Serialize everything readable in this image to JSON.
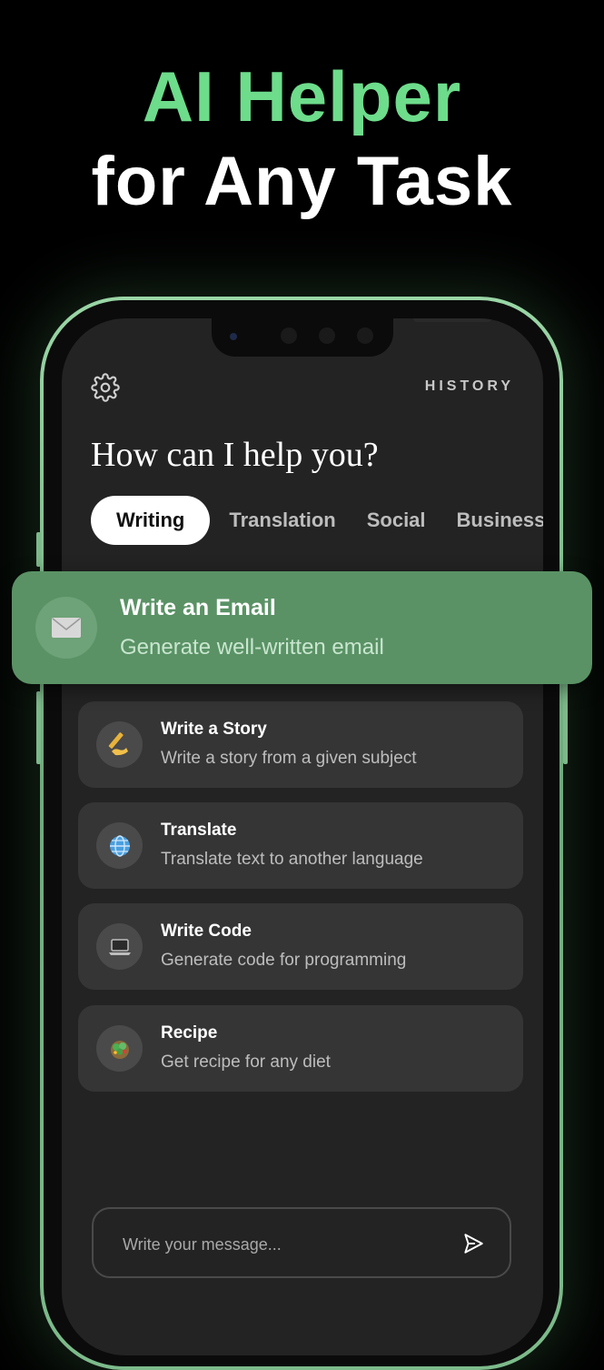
{
  "hero": {
    "line1": "AI Helper",
    "line2": "for Any Task"
  },
  "app": {
    "history_label": "HISTORY",
    "heading": "How can I help you?",
    "tabs": [
      {
        "label": "Writing",
        "active": true
      },
      {
        "label": "Translation",
        "active": false
      },
      {
        "label": "Social",
        "active": false
      },
      {
        "label": "Business",
        "active": false
      }
    ],
    "featured": {
      "title": "Write an Email",
      "subtitle": "Generate well-written email",
      "icon": "envelope-icon"
    },
    "cards": [
      {
        "title": "Write a Story",
        "subtitle": "Write a story from a given subject",
        "icon": "writing-hand-icon"
      },
      {
        "title": "Translate",
        "subtitle": "Translate text to another language",
        "icon": "globe-icon"
      },
      {
        "title": "Write Code",
        "subtitle": "Generate code for programming",
        "icon": "laptop-icon"
      },
      {
        "title": "Recipe",
        "subtitle": "Get recipe for any diet",
        "icon": "salad-icon"
      }
    ],
    "composer": {
      "placeholder": "Write your message..."
    }
  },
  "colors": {
    "accent": "#6ddc8b",
    "featured_bg": "#5a9265",
    "screen_bg": "#232323",
    "card_bg": "#353535"
  }
}
